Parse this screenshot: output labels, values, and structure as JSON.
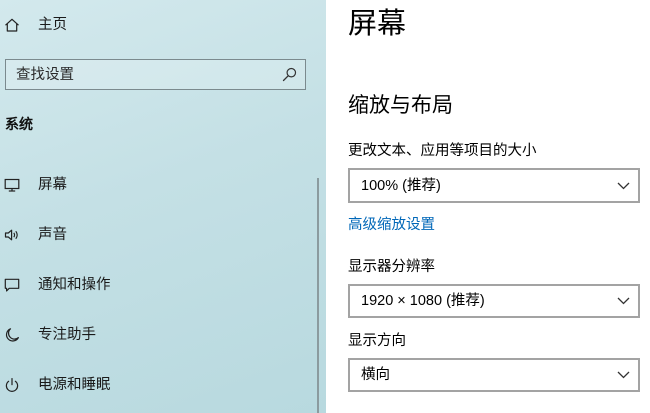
{
  "sidebar": {
    "home": {
      "label": "主页",
      "icon": "home-icon"
    },
    "search": {
      "placeholder": "查找设置",
      "icon": "search-icon"
    },
    "section_title": "系统",
    "items": [
      {
        "label": "屏幕",
        "icon": "monitor-icon"
      },
      {
        "label": "声音",
        "icon": "speaker-icon"
      },
      {
        "label": "通知和操作",
        "icon": "notification-icon"
      },
      {
        "label": "专注助手",
        "icon": "moon-icon"
      },
      {
        "label": "电源和睡眠",
        "icon": "power-icon"
      }
    ]
  },
  "main": {
    "title": "屏幕",
    "section": "缩放与布局",
    "scale": {
      "label": "更改文本、应用等项目的大小",
      "value": "100% (推荐)"
    },
    "advanced_link": "高级缩放设置",
    "resolution": {
      "label": "显示器分辨率",
      "value": "1920 × 1080 (推荐)"
    },
    "orientation": {
      "label": "显示方向",
      "value": "横向"
    }
  },
  "colors": {
    "link": "#0067b8",
    "sidebar_bg": "#c4e0e5",
    "text": "#000000",
    "dropdown_border": "#a3a3a3"
  }
}
